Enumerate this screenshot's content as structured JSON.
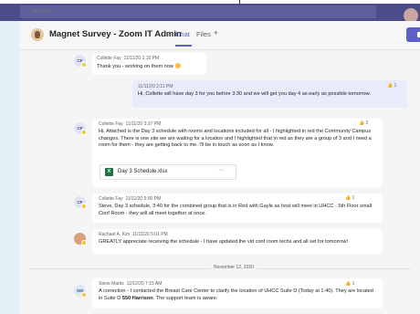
{
  "search": {
    "placeholder": "Search"
  },
  "header": {
    "title": "Magnet Survey - Zoom IT Admin",
    "tabs": [
      {
        "label": "Chat",
        "active": true
      },
      {
        "label": "Files",
        "active": false
      }
    ]
  },
  "messages": [
    {
      "initials": "CF",
      "author": "Collette Fay",
      "timestamp": "11/11/20 1:16 PM",
      "text": "Thank you - working on them now",
      "emoji": "smiley"
    },
    {
      "mine": true,
      "timestamp": "11/11/20 2:11 PM",
      "text": "Hi, Collette will have day 3 for you before 3:30 and we will get you day 4 as early as possible tomorrow.",
      "reaction_count": "1"
    },
    {
      "initials": "CF",
      "author": "Collette Fay",
      "timestamp": "11/11/20 3:37 PM",
      "text": "Hi, Attached is the Day 3 schedule with rooms and locations included for all - I highlighted in red the Community Campus changes. There is one site we are waiting for a location and I highlighted that in red as they are a group of 3 and I need a room for them - they are getting back to me. I'll be in touch as soon as I know.",
      "reaction_count": "2",
      "attachment": "Day 3 Schedule.xlsx"
    },
    {
      "initials": "CF",
      "author": "Collette Fay",
      "timestamp": "11/11/20 5:00 PM",
      "text": "Steve, Day 3 schedule, 3:40 for the combined group that is in Red with Gayle as host will meet in UHCC - 5th Floor small Conf Room - they will all meet together at once.",
      "reaction_count": "1"
    },
    {
      "initials": "",
      "author": "Rachael A. Kim",
      "timestamp": "11/11/20 5:01 PM",
      "text": "GREATLY appreciate receiving the schedule - I have updated the vid conf room techs and all set for tomorrow!"
    },
    {
      "initials": "SM",
      "author": "Steve Marks",
      "timestamp": "11/12/20 7:15 AM",
      "text_parts": [
        "A correction - I contacted the Breast Care Center to clarify the location of UHCC Suite D (Today at 1:40). They are located in Suite D ",
        "550 Harrison",
        ". The support team is aware."
      ],
      "reaction_count": "1"
    }
  ],
  "date_divider": "November 12, 2020"
}
